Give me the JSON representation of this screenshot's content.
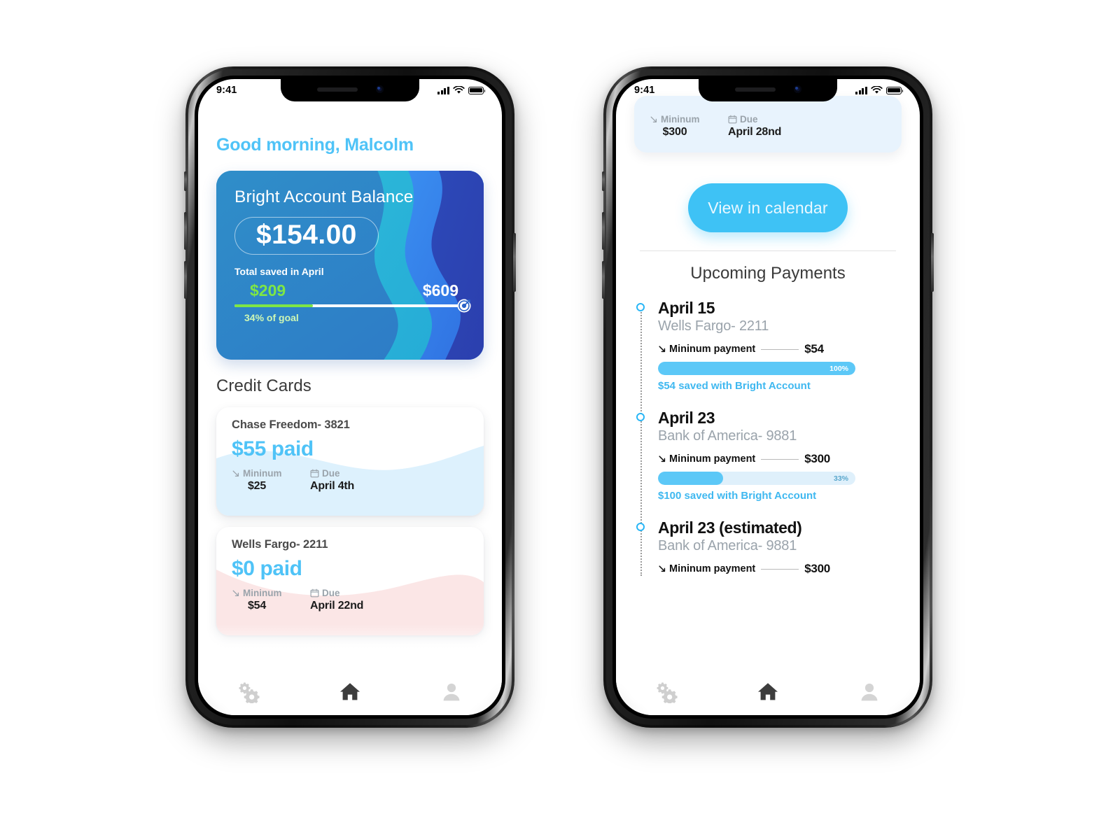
{
  "phone1": {
    "status_bar": {
      "time": "9:41"
    },
    "greeting": "Good morning, Malcolm",
    "balance_card": {
      "title": "Bright Account Balance",
      "amount": "$154.00",
      "saved_label": "Total saved in April",
      "saved_amount": "$209",
      "goal_amount": "$609",
      "progress_text": "34% of goal",
      "progress_percent": 34,
      "colors": {
        "saved": "#7ee645",
        "card_start": "#2f86c7",
        "card_end": "#2f5fd0"
      }
    },
    "section_title": "Credit Cards",
    "credit_cards": [
      {
        "name": "Chase Freedom- 3821",
        "paid": "$55 paid",
        "minimum_label": "Mininum",
        "minimum_value": "$25",
        "due_label": "Due",
        "due_value": "April 4th",
        "tint": "#ddf1fd"
      },
      {
        "name": "Wells Fargo- 2211",
        "paid": "$0 paid",
        "minimum_label": "Mininum",
        "minimum_value": "$54",
        "due_label": "Due",
        "due_value": "April 22nd",
        "tint": "#fbe6e6"
      }
    ],
    "tabbar": {
      "settings": "settings-gears-icon",
      "home": "home-icon",
      "profile": "profile-icon"
    }
  },
  "phone2": {
    "status_bar": {
      "time": "9:41"
    },
    "top_card": {
      "minimum_label": "Mininum",
      "minimum_value": "$300",
      "due_label": "Due",
      "due_value": "April 28nd"
    },
    "calendar_button": "View in calendar",
    "upcoming_title": "Upcoming Payments",
    "payments": [
      {
        "date": "April 15",
        "bank": "Wells Fargo- 2211",
        "minimum_label": "Mininum payment",
        "amount": "$54",
        "percent": 100,
        "percent_text": "100%",
        "saved_text": "$54 saved with Bright Account"
      },
      {
        "date": "April 23",
        "bank": "Bank of America- 9881",
        "minimum_label": "Mininum payment",
        "amount": "$300",
        "percent": 33,
        "percent_text": "33%",
        "saved_text": "$100 saved with Bright Account"
      },
      {
        "date": "April 23 (estimated)",
        "bank": "Bank of America- 9881",
        "minimum_label": "Mininum payment",
        "amount": "$300",
        "percent": 0,
        "percent_text": "",
        "saved_text": ""
      }
    ],
    "tabbar": {
      "settings": "settings-gears-icon",
      "home": "home-icon",
      "profile": "profile-icon"
    }
  }
}
